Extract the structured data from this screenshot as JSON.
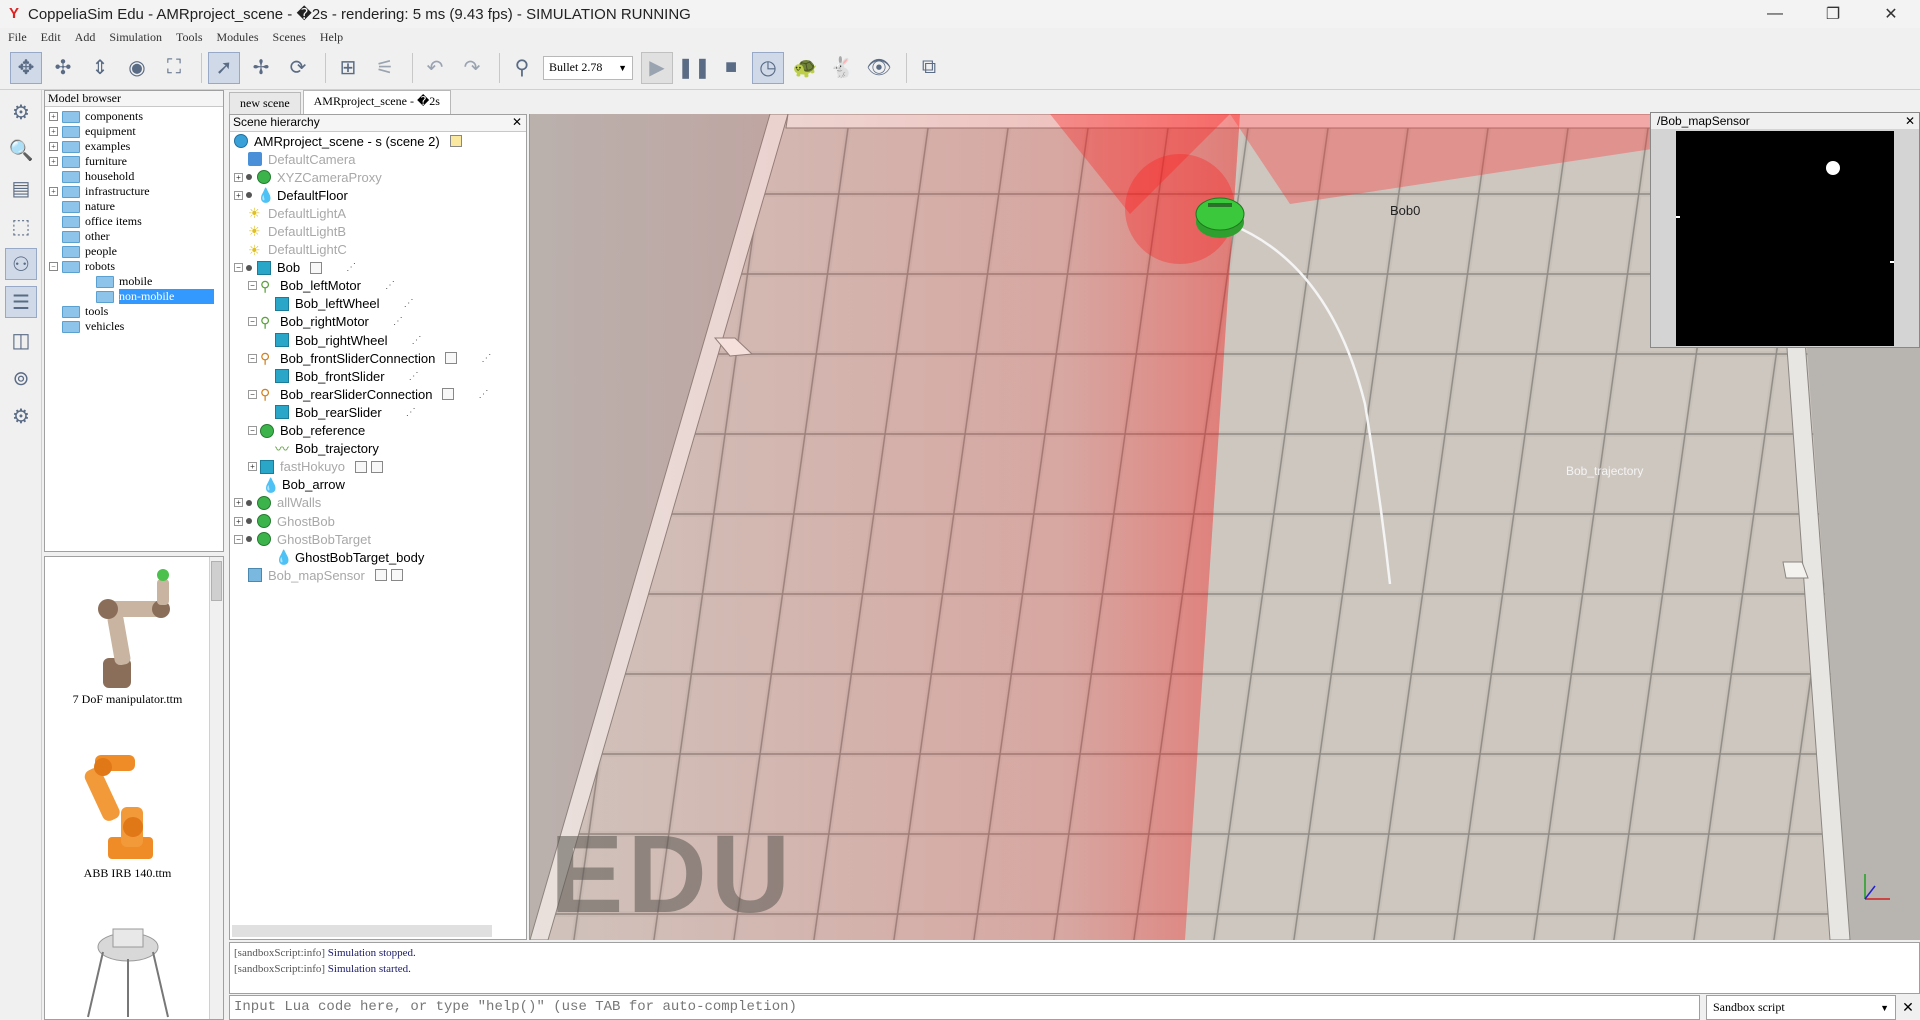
{
  "window": {
    "title": "CoppeliaSim Edu - AMRproject_scene - �2s - rendering: 5 ms (9.43 fps) - SIMULATION RUNNING",
    "minimize": "—",
    "restore": "❐",
    "close": "✕"
  },
  "menu": [
    "File",
    "Edit",
    "Add",
    "Simulation",
    "Tools",
    "Modules",
    "Scenes",
    "Help"
  ],
  "toolbar": {
    "physics_engine": "Bullet 2.78",
    "icons": [
      "pan-icon",
      "translate-icon",
      "move-icon",
      "camera-fit-icon",
      "zoom-fit-icon",
      "select-icon",
      "object-shift-icon",
      "object-rotate-icon",
      "assembly-icon",
      "transfer-dna-icon",
      "undo-icon",
      "redo-icon",
      "sim-settings-icon",
      "play-icon",
      "pause-icon",
      "stop-icon",
      "realtime-icon",
      "slow-icon",
      "fast-icon",
      "visualization-icon",
      "page-selector-icon"
    ]
  },
  "model_browser": {
    "title": "Model browser",
    "items": [
      {
        "label": "components",
        "expander": "+"
      },
      {
        "label": "equipment",
        "expander": "+"
      },
      {
        "label": "examples",
        "expander": "+"
      },
      {
        "label": "furniture",
        "expander": "+"
      },
      {
        "label": "household",
        "expander": ""
      },
      {
        "label": "infrastructure",
        "expander": "+"
      },
      {
        "label": "nature",
        "expander": ""
      },
      {
        "label": "office items",
        "expander": ""
      },
      {
        "label": "other",
        "expander": ""
      },
      {
        "label": "people",
        "expander": ""
      },
      {
        "label": "robots",
        "expander": "−"
      },
      {
        "label": "mobile",
        "expander": "",
        "child": true
      },
      {
        "label": "non-mobile",
        "expander": "",
        "child": true,
        "selected": true
      },
      {
        "label": "tools",
        "expander": ""
      },
      {
        "label": "vehicles",
        "expander": ""
      }
    ],
    "thumbnails": [
      "7 DoF manipulator.ttm",
      "ABB IRB 140.ttm"
    ]
  },
  "scene_tabs": [
    "new scene",
    "AMRproject_scene - �2s"
  ],
  "hierarchy": {
    "title": "Scene hierarchy",
    "root": "AMRproject_scene - s (scene 2)",
    "rows": [
      {
        "label": "DefaultCamera",
        "dim": true
      },
      {
        "label": "XYZCameraProxy",
        "dim": true
      },
      {
        "label": "DefaultFloor",
        "dim": false
      },
      {
        "label": "DefaultLightA",
        "dim": true
      },
      {
        "label": "DefaultLightB",
        "dim": true
      },
      {
        "label": "DefaultLightC",
        "dim": true
      },
      {
        "label": "Bob",
        "dim": false
      },
      {
        "label": "Bob_leftMotor",
        "dim": false
      },
      {
        "label": "Bob_leftWheel",
        "dim": false
      },
      {
        "label": "Bob_rightMotor",
        "dim": false
      },
      {
        "label": "Bob_rightWheel",
        "dim": false
      },
      {
        "label": "Bob_frontSliderConnection",
        "dim": false
      },
      {
        "label": "Bob_frontSlider",
        "dim": false
      },
      {
        "label": "Bob_rearSliderConnection",
        "dim": false
      },
      {
        "label": "Bob_rearSlider",
        "dim": false
      },
      {
        "label": "Bob_reference",
        "dim": false
      },
      {
        "label": "Bob_trajectory",
        "dim": false
      },
      {
        "label": "fastHokuyo",
        "dim": true
      },
      {
        "label": "Bob_arrow",
        "dim": false
      },
      {
        "label": "allWalls",
        "dim": true
      },
      {
        "label": "GhostBob",
        "dim": true
      },
      {
        "label": "GhostBobTarget",
        "dim": true
      },
      {
        "label": "GhostBobTarget_body",
        "dim": false
      },
      {
        "label": "Bob_mapSensor",
        "dim": true
      }
    ]
  },
  "viewport": {
    "watermark": "EDU",
    "robot_label": "Bob0",
    "trajectory_label": "Bob_trajectory",
    "axes": {
      "x": "x",
      "y": "y",
      "z": "z"
    }
  },
  "sensor_view": {
    "title": "/Bob_mapSensor",
    "close": "✕"
  },
  "console": {
    "lines": [
      {
        "prefix": "[sandboxScript:info]",
        "message": "Simulation stopped."
      },
      {
        "prefix": "[sandboxScript:info]",
        "message": "Simulation started."
      }
    ]
  },
  "lua_input": {
    "placeholder": "Input Lua code here, or type \"help()\" (use TAB for auto-completion)",
    "script_selector": "Sandbox script"
  },
  "colors": {
    "selection": "#3399ff",
    "laser": "#ff2020",
    "robot": "#3cc83c"
  }
}
